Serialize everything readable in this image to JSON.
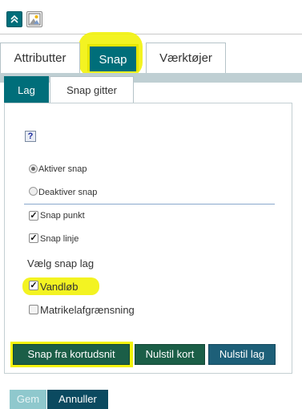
{
  "main_tabs": [
    {
      "label": "Attributter",
      "active": false
    },
    {
      "label": "Snap",
      "active": true
    },
    {
      "label": "Værktøjer",
      "active": false
    }
  ],
  "sub_tabs": [
    {
      "label": "Lag",
      "active": true
    },
    {
      "label": "Snap gitter",
      "active": false
    }
  ],
  "help_glyph": "?",
  "snap_mode": {
    "options": [
      {
        "label": "Aktiver snap",
        "checked": true
      },
      {
        "label": "Deaktiver snap",
        "checked": false
      }
    ]
  },
  "snap_types": [
    {
      "label": "Snap punkt",
      "checked": true
    },
    {
      "label": "Snap linje",
      "checked": true
    }
  ],
  "layers": {
    "heading": "Vælg snap lag",
    "items": [
      {
        "label": "Vandløb",
        "checked": true
      },
      {
        "label": "Matrikelafgrænsning",
        "checked": false
      }
    ]
  },
  "actions": {
    "snap_from_map": "Snap fra kortudsnit",
    "reset_map": "Nulstil kort",
    "reset_layer": "Nulstil lag"
  },
  "footer": {
    "save": "Gem",
    "cancel": "Annuller"
  },
  "colors": {
    "teal": "#006e7a",
    "highlight": "#f2f20a",
    "green_button": "#1b5e47",
    "blue_button": "#1d5f78"
  },
  "icons": [
    "collapse-up-icon",
    "picture-icon",
    "help-icon"
  ]
}
